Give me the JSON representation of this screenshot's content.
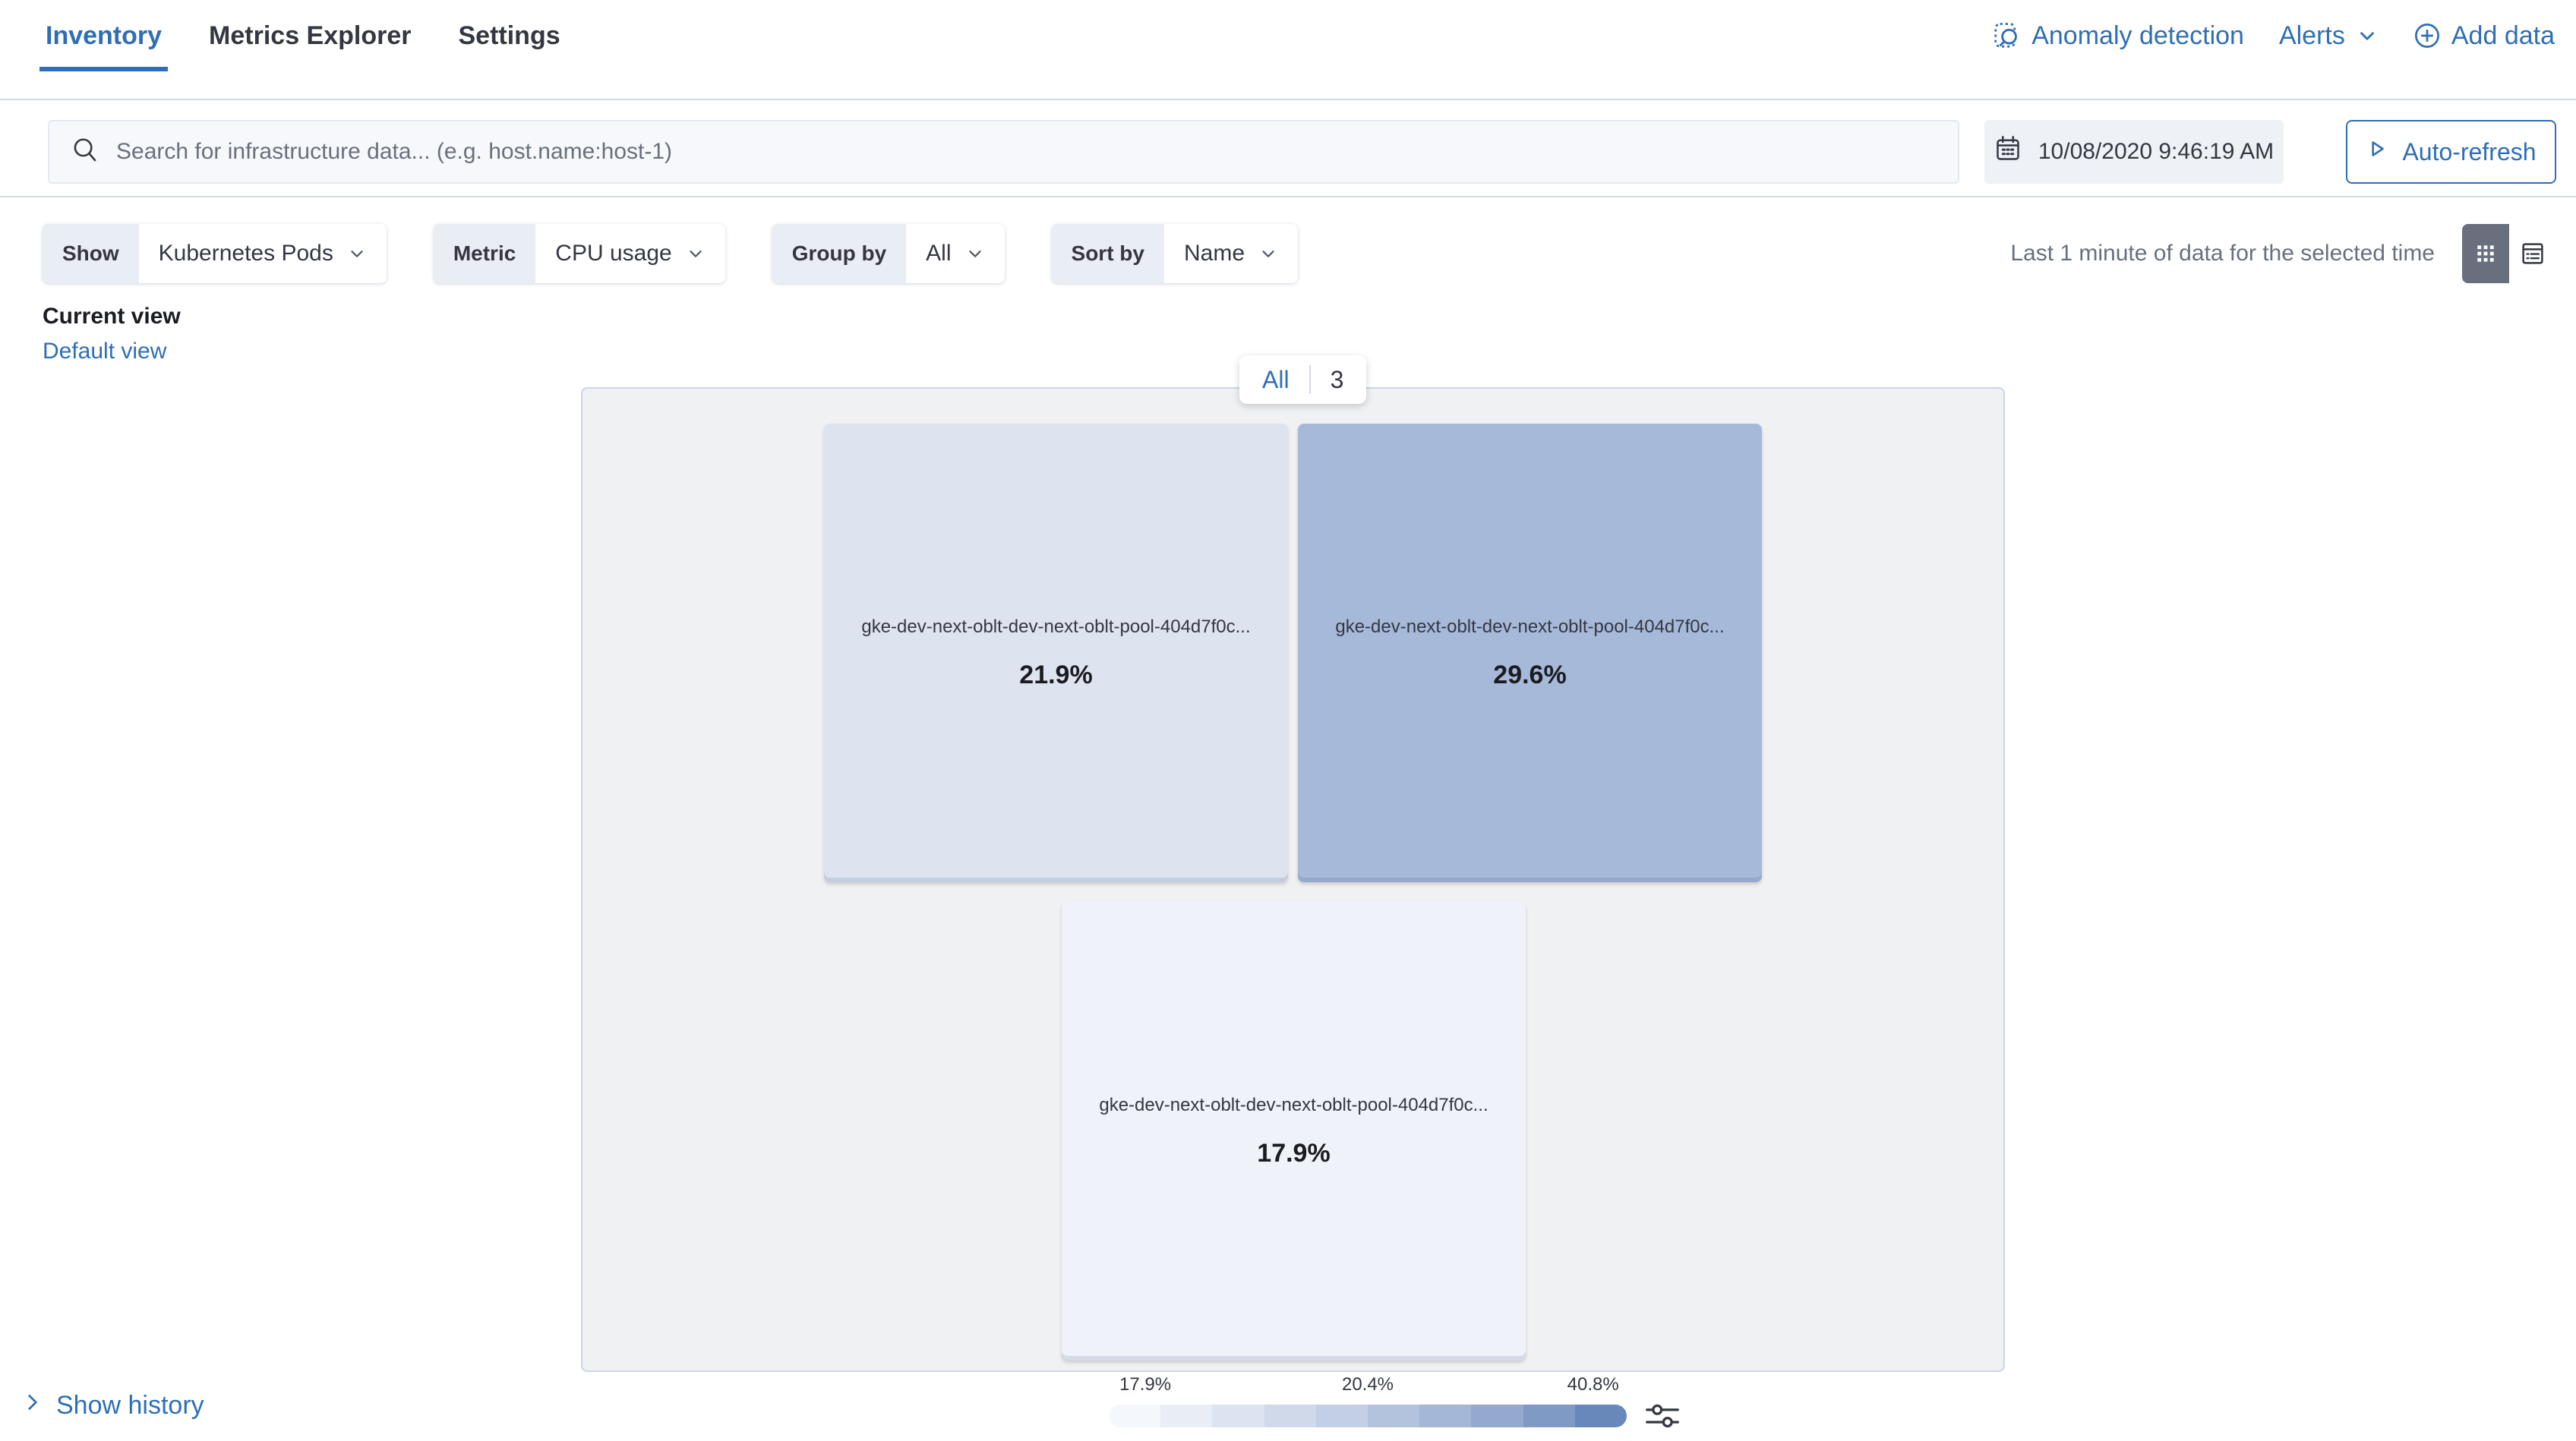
{
  "nav": {
    "tabs": [
      {
        "label": "Inventory",
        "active": true
      },
      {
        "label": "Metrics Explorer",
        "active": false
      },
      {
        "label": "Settings",
        "active": false
      }
    ],
    "actions": {
      "anomaly_detection": "Anomaly detection",
      "alerts": "Alerts",
      "add_data": "Add data"
    }
  },
  "search": {
    "placeholder": "Search for infrastructure data... (e.g. host.name:host-1)"
  },
  "time": {
    "datetime": "10/08/2020 9:46:19 AM",
    "auto_refresh": "Auto-refresh"
  },
  "filters": [
    {
      "label": "Show",
      "value": "Kubernetes Pods"
    },
    {
      "label": "Metric",
      "value": "CPU usage"
    },
    {
      "label": "Group by",
      "value": "All"
    },
    {
      "label": "Sort by",
      "value": "Name"
    }
  ],
  "hint": "Last 1 minute of data for the selected time",
  "view": {
    "current": "Current view",
    "default_link": "Default view"
  },
  "group_badge": {
    "all_label": "All",
    "count": "3"
  },
  "nodes": [
    {
      "label": "gke-dev-next-oblt-dev-next-oblt-pool-404d7f0c...",
      "value": "21.9%",
      "color": "#dde4f0"
    },
    {
      "label": "gke-dev-next-oblt-dev-next-oblt-pool-404d7f0c...",
      "value": "29.6%",
      "color": "#a6b9d9"
    },
    {
      "label": "gke-dev-next-oblt-dev-next-oblt-pool-404d7f0c...",
      "value": "17.9%",
      "color": "#eff2f9"
    }
  ],
  "legend": {
    "labels": [
      {
        "text": "17.9%"
      },
      {
        "text": "20.4%"
      },
      {
        "text": "40.8%"
      }
    ],
    "gradient": [
      "#f4f7fb",
      "#e8edf6",
      "#dce3f1",
      "#cfd9ea",
      "#c2cfe4",
      "#b3c3dd",
      "#a4b7d6",
      "#93a9cd",
      "#7f9ac4",
      "#6788b8"
    ]
  },
  "history": {
    "label": "Show history"
  },
  "colors": {
    "accent": "#2f6eb5",
    "text": "#343741",
    "muted": "#69707d",
    "divider": "#d3dae6",
    "map_bg": "#f0f1f3"
  }
}
